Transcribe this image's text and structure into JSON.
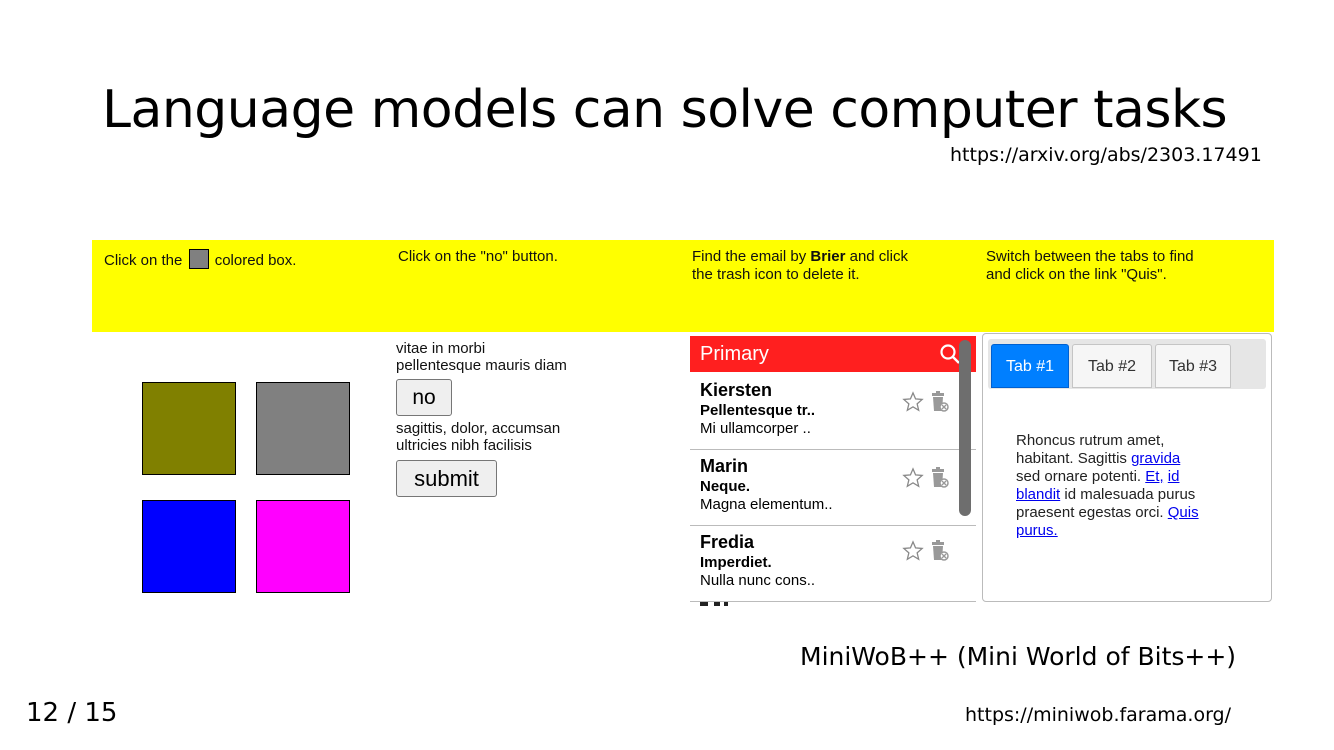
{
  "slide": {
    "title": "Language models can solve computer tasks",
    "ref_top": "https://arxiv.org/abs/2303.17491",
    "caption": "MiniWoB++ (Mini World of Bits++)",
    "ref_bottom": "https://miniwob.farama.org/",
    "page_number": "12",
    "page_sep": "/",
    "page_total": "15"
  },
  "colors": {
    "instruction_bg": "#ffff00",
    "target_swatch": "#808080",
    "box_olive": "#808000",
    "box_gray": "#808080",
    "box_blue": "#0000ff",
    "box_magenta": "#ff00ff",
    "email_header": "#ff1f1f",
    "active_tab": "#007fff"
  },
  "task1": {
    "instr_before": "Click on the",
    "instr_after": "colored box."
  },
  "task2": {
    "instruction": "Click on the \"no\" button.",
    "text1_line1": "vitae in morbi",
    "text1_line2": "pellentesque mauris diam",
    "no_button": "no",
    "text2_line1": "sagittis, dolor, accumsan",
    "text2_line2": "ultricies nibh facilisis",
    "submit_button": "submit"
  },
  "task3": {
    "instr_line1_before": "Find the email by",
    "instr_name": "Brier",
    "instr_line1_after": "and click",
    "instr_line2": "the trash icon to delete it.",
    "header": "Primary",
    "emails": [
      {
        "from": "Kiersten",
        "subject": "Pellentesque tr..",
        "body": "Mi ullamcorper .."
      },
      {
        "from": "Marin",
        "subject": "Neque.",
        "body": "Magna elementum.."
      },
      {
        "from": "Fredia",
        "subject": "Imperdiet.",
        "body": "Nulla nunc cons.."
      }
    ]
  },
  "task4": {
    "instr_line1": "Switch between the tabs to find",
    "instr_line2": "and click on the link \"Quis\".",
    "tabs": [
      "Tab #1",
      "Tab #2",
      "Tab #3"
    ],
    "p1": "Rhoncus rutrum amet,",
    "p2": "habitant. Sagittis",
    "link_gravida": "gravida",
    "p3": "sed ornare potenti.",
    "link_et": "Et,",
    "link_id": "id",
    "link_blandit": "blandit",
    "p4": "id malesuada purus",
    "p5": "praesent egestas orci.",
    "link_quis": "Quis",
    "link_purus": "purus."
  }
}
